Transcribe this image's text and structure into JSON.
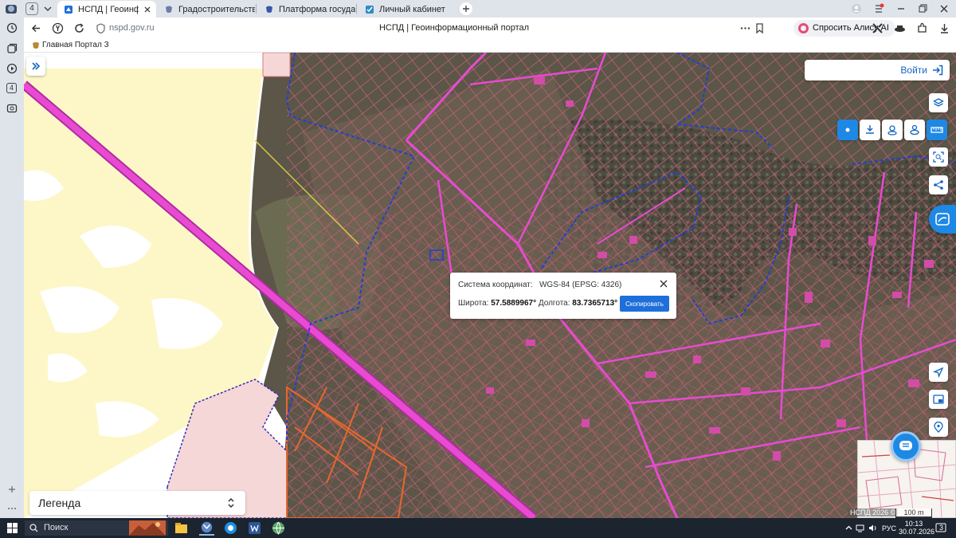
{
  "browser": {
    "tab_counter": "4",
    "tabs": [
      {
        "title": "НСПД | Геоинформационный портал",
        "active": true
      },
      {
        "title": "Градостроительство",
        "active": false
      },
      {
        "title": "Платформа государственных услуг",
        "active": false
      },
      {
        "title": "Личный кабинет",
        "active": false
      }
    ],
    "url": "nspd.gov.ru",
    "page_title": "НСПД | Геоинформационный портал",
    "alisa_label": "Спросить Алису AI",
    "bookmarks": [
      {
        "label": "Главная Портал З"
      }
    ],
    "sidebar_badge": "4"
  },
  "map": {
    "login_label": "Войти",
    "legend_label": "Легенда",
    "attribution": "НСПД 2026 ©",
    "scale_label": "100 m",
    "coord_popup": {
      "system_label": "Система координат:",
      "system_value": "WGS-84 (EPSG: 4326)",
      "lat_label": "Широта:",
      "lat_value": "57.5889967°",
      "lon_label": "Долгота:",
      "lon_value": "83.7365713°",
      "copy_label": "Скопировать"
    },
    "colors": {
      "accent": "#1e88e5",
      "boundary_blue": "#1f3fd6",
      "road_magenta": "#e84bd1",
      "parcel_pink": "#d34ca8",
      "orange": "#e8672e"
    }
  },
  "taskbar": {
    "search_label": "Поиск",
    "lang": "РУС",
    "time": "10:13",
    "date": "30.07.2026",
    "notif_count": "3"
  }
}
